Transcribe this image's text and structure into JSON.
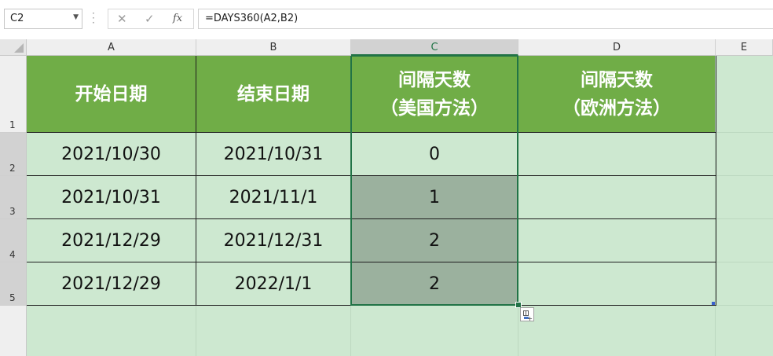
{
  "name_box": {
    "value": "C2"
  },
  "formula_bar": {
    "cancel_icon": "✕",
    "enter_icon": "✓",
    "fx_label": "fx",
    "formula": "=DAYS360(A2,B2)"
  },
  "columns": [
    "A",
    "B",
    "C",
    "D",
    "E"
  ],
  "rows": [
    "1",
    "2",
    "3",
    "4",
    "5"
  ],
  "selected_column": "C",
  "table": {
    "headers": [
      {
        "line1": "开始日期",
        "line2": ""
      },
      {
        "line1": "结束日期",
        "line2": ""
      },
      {
        "line1": "间隔天数",
        "line2": "（美国方法）"
      },
      {
        "line1": "间隔天数",
        "line2": "（欧洲方法）"
      }
    ],
    "rows": [
      {
        "start": "2021/10/30",
        "end": "2021/10/31",
        "us": "0",
        "eu": ""
      },
      {
        "start": "2021/10/31",
        "end": "2021/11/1",
        "us": "1",
        "eu": ""
      },
      {
        "start": "2021/12/29",
        "end": "2021/12/31",
        "us": "2",
        "eu": ""
      },
      {
        "start": "2021/12/29",
        "end": "2022/1/1",
        "us": "2",
        "eu": ""
      }
    ]
  },
  "colors": {
    "header_fill": "#70ad47",
    "cell_fill": "#cde8d0",
    "selection_fill": "#9bb19e",
    "selection_border": "#217346"
  },
  "quick_analysis_icon": "quick-analysis-icon"
}
